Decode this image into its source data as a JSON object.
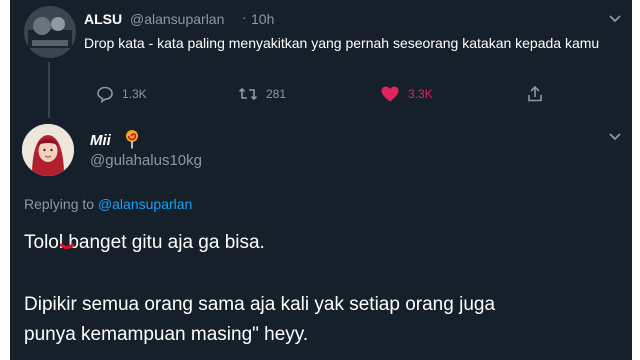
{
  "tweet": {
    "author_name": "ALSU",
    "author_handle": "@alansuparlan",
    "separator": "·",
    "time": "10h",
    "text": "Drop kata - kata paling menyakitkan yang pernah seseorang katakan kepada kamu",
    "stats": {
      "replies": "1.3K",
      "retweets": "281",
      "likes": "3.3K"
    }
  },
  "reply": {
    "author_name": "Mii",
    "author_handle": "@gulahalus10kg",
    "replying_prefix": "Replying to",
    "replying_to": "@alansuparlan",
    "lines": [
      "Tolol banget gitu aja ga bisa.",
      "Dipikir semua orang sama aja kali yak setiap orang juga",
      "punya kemampuan masing\" heyy."
    ]
  },
  "colors": {
    "background": "#15202b",
    "secondary_text": "#8899a6",
    "like": "#e0245e",
    "link": "#1da1f2"
  },
  "icons": [
    "reply-icon",
    "retweet-icon",
    "heart-icon",
    "share-icon",
    "chevron-down-icon",
    "lollipop-icon"
  ]
}
